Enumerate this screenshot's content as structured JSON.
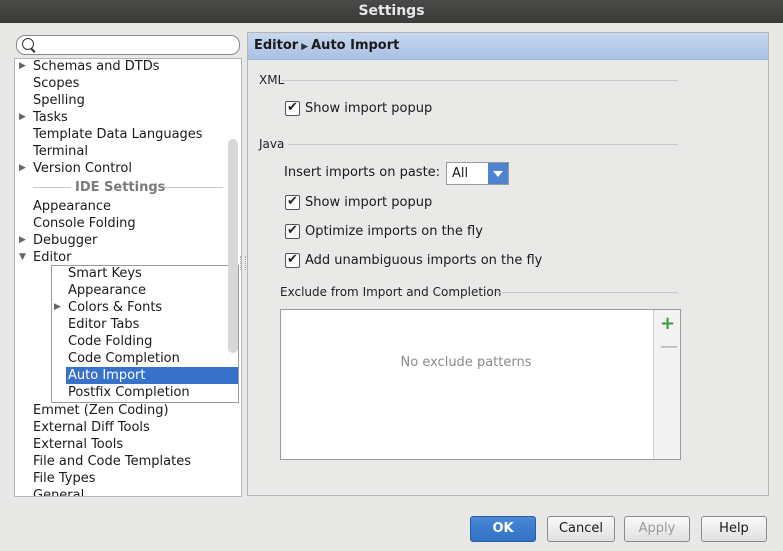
{
  "window": {
    "title": "Settings"
  },
  "search": {
    "placeholder": ""
  },
  "tree": {
    "items_top": [
      {
        "label": "Schemas and DTDs",
        "expandable": true
      },
      {
        "label": "Scopes",
        "expandable": false
      },
      {
        "label": "Spelling",
        "expandable": false
      },
      {
        "label": "Tasks",
        "expandable": true
      },
      {
        "label": "Template Data Languages",
        "expandable": false
      },
      {
        "label": "Terminal",
        "expandable": false
      },
      {
        "label": "Version Control",
        "expandable": true
      }
    ],
    "section": "IDE Settings",
    "items_ide": [
      {
        "label": "Appearance",
        "expandable": false
      },
      {
        "label": "Console Folding",
        "expandable": false
      },
      {
        "label": "Debugger",
        "expandable": true
      },
      {
        "label": "Editor",
        "expandable": true,
        "expanded": true
      }
    ],
    "editor_children": [
      {
        "label": "Smart Keys"
      },
      {
        "label": "Appearance"
      },
      {
        "label": "Colors & Fonts",
        "expandable": true
      },
      {
        "label": "Editor Tabs"
      },
      {
        "label": "Code Folding"
      },
      {
        "label": "Code Completion"
      },
      {
        "label": "Auto Import",
        "selected": true
      },
      {
        "label": "Postfix Completion"
      }
    ],
    "items_bottom": [
      {
        "label": "Emmet (Zen Coding)"
      },
      {
        "label": "External Diff Tools"
      },
      {
        "label": "External Tools"
      },
      {
        "label": "File and Code Templates"
      },
      {
        "label": "File Types"
      },
      {
        "label": "General"
      }
    ]
  },
  "panel": {
    "breadcrumb_parent": "Editor",
    "breadcrumb_current": "Auto Import",
    "xml_group": "XML",
    "xml_show_popup": "Show import popup",
    "java_group": "Java",
    "insert_imports_label": "Insert imports on paste:",
    "insert_imports_value": "All",
    "java_show_popup": "Show import popup",
    "optimize_imports": "Optimize imports on the fly",
    "add_unambiguous": "Add unambiguous imports on the fly",
    "exclude_group": "Exclude from Import and Completion",
    "exclude_empty": "No exclude patterns",
    "add_icon": "+",
    "remove_icon": "—"
  },
  "buttons": {
    "ok": "OK",
    "cancel": "Cancel",
    "apply": "Apply",
    "help": "Help"
  },
  "colors": {
    "accent": "#3871c9",
    "header": "#aac1e3",
    "add": "#3c9a3c"
  }
}
